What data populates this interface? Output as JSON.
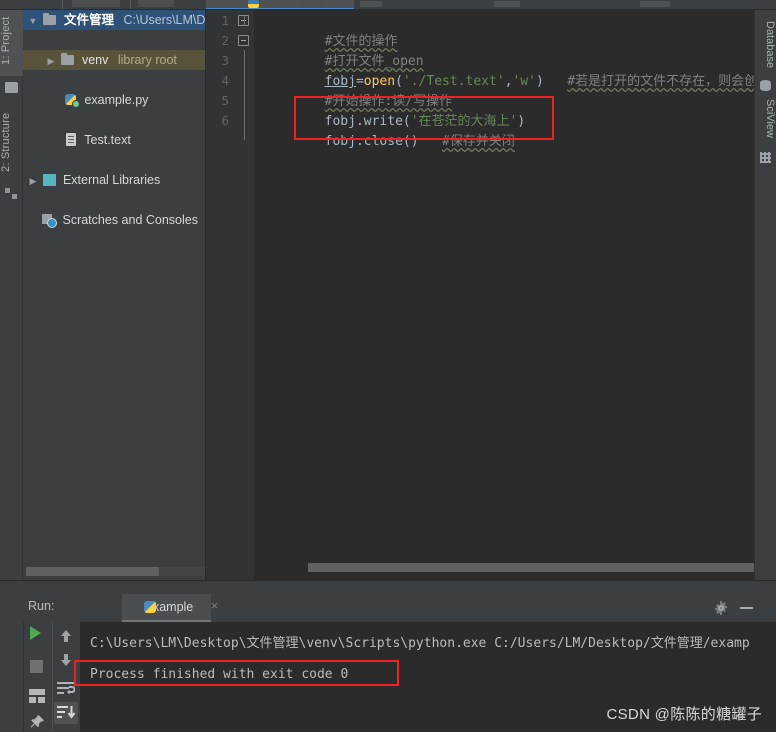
{
  "window": {
    "theme_bg": "#3c3f41",
    "editor_bg": "#2b2b2b",
    "accent": "#4a88c7",
    "highlight_red": "#ee2222"
  },
  "left_tool_tabs": [
    {
      "label": "1: Project",
      "icon": "folder-icon",
      "selected": true
    },
    {
      "label": "2: Structure",
      "icon": "structure-icon",
      "selected": false
    }
  ],
  "right_tool_tabs": [
    {
      "label": "Database",
      "icon": "database-icon"
    },
    {
      "label": "SciView",
      "icon": "sciview-icon"
    }
  ],
  "project_tree": [
    {
      "arrow": "▼",
      "icon": "folder-icon",
      "label": "文件管理",
      "sublabel": "C:\\Users\\LM\\De",
      "indent": 0,
      "state": "selected-blue"
    },
    {
      "arrow": "▶",
      "icon": "folder-icon",
      "label": "venv",
      "sublabel": "library root",
      "indent": 1,
      "state": "selected-olive"
    },
    {
      "arrow": "",
      "icon": "python-file-icon",
      "label": "example.py",
      "sublabel": "",
      "indent": 2,
      "state": "none"
    },
    {
      "arrow": "",
      "icon": "text-file-icon",
      "label": "Test.text",
      "sublabel": "",
      "indent": 2,
      "state": "none"
    },
    {
      "arrow": "▶",
      "icon": "library-icon",
      "label": "External Libraries",
      "sublabel": "",
      "indent": 0,
      "state": "none"
    },
    {
      "arrow": "",
      "icon": "scratches-icon",
      "label": "Scratches and Consoles",
      "sublabel": "",
      "indent": 0,
      "state": "none"
    }
  ],
  "editor": {
    "line_numbers": [
      "1",
      "2",
      "3",
      "4",
      "5",
      "6"
    ],
    "lines": [
      {
        "n": 1,
        "tokens": [
          {
            "t": "#文件的操作",
            "c": "comment-spellcheck"
          }
        ]
      },
      {
        "n": 2,
        "tokens": [
          {
            "t": "#打开文件_open",
            "c": "comment-spellcheck"
          }
        ]
      },
      {
        "n": 3,
        "tokens": [
          {
            "t": "fobj",
            "c": "identifier-underline"
          },
          {
            "t": "=",
            "c": "identifier"
          },
          {
            "t": "open",
            "c": "function"
          },
          {
            "t": "(",
            "c": "identifier"
          },
          {
            "t": "'./Test.text'",
            "c": "string"
          },
          {
            "t": ",",
            "c": "identifier"
          },
          {
            "t": "'w'",
            "c": "string"
          },
          {
            "t": ")",
            "c": "identifier"
          },
          {
            "t": "   ",
            "c": "identifier"
          },
          {
            "t": "#若是打开的文件不存在，则会创建这个文件",
            "c": "comment-spellcheck"
          }
        ]
      },
      {
        "n": 4,
        "tokens": [
          {
            "t": "#开始操作:读/写操作",
            "c": "comment-spellcheck"
          }
        ]
      },
      {
        "n": 5,
        "tokens": [
          {
            "t": "fobj",
            "c": "identifier"
          },
          {
            "t": ".write(",
            "c": "identifier"
          },
          {
            "t": "'在苍茫的大海上'",
            "c": "string"
          },
          {
            "t": ")",
            "c": "identifier"
          }
        ]
      },
      {
        "n": 6,
        "tokens": [
          {
            "t": "fobj",
            "c": "identifier"
          },
          {
            "t": ".close()",
            "c": "identifier"
          },
          {
            "t": "   ",
            "c": "identifier"
          },
          {
            "t": "#保存并关闭",
            "c": "comment-spellcheck"
          }
        ]
      }
    ],
    "highlight_box_lines": "5-6"
  },
  "run_panel": {
    "label": "Run:",
    "tab_name": "example",
    "tab_close": "×",
    "gear_icon": "gear-icon",
    "minimize_icon": "minimize-icon",
    "toolbar": [
      {
        "name": "rerun-button",
        "icon": "play-icon"
      },
      {
        "name": "stop-button",
        "icon": "stop-icon"
      },
      {
        "name": "layout-button",
        "icon": "layout-icon"
      },
      {
        "name": "pin-button",
        "icon": "pin-icon"
      },
      {
        "name": "up-button",
        "icon": "arrow-up-icon"
      },
      {
        "name": "down-button",
        "icon": "arrow-down-icon"
      },
      {
        "name": "soft-wrap-button",
        "icon": "wrap-icon"
      },
      {
        "name": "scroll-to-end-button",
        "icon": "scroll-end-icon"
      }
    ],
    "console_lines": [
      "C:\\Users\\LM\\Desktop\\文件管理\\venv\\Scripts\\python.exe C:/Users/LM/Desktop/文件管理/examp",
      "",
      "Process finished with exit code 0"
    ],
    "highlighted_output": "Process finished with exit code 0"
  },
  "watermark": "CSDN @陈陈的糖罐子"
}
